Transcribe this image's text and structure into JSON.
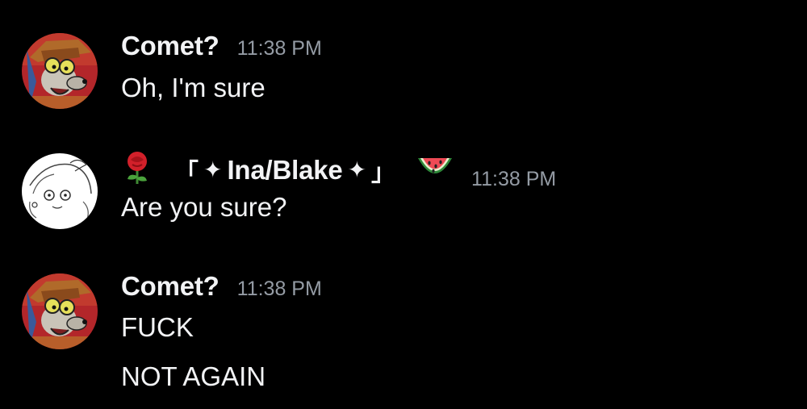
{
  "messages": [
    {
      "author": "Comet?",
      "timestamp": "11:38 PM",
      "lines": [
        "Oh, I'm sure"
      ]
    },
    {
      "author_prefix": "「",
      "author_sparkle_left": "✦",
      "author": "Ina/Blake",
      "author_sparkle_right": "✦",
      "author_suffix": "」",
      "timestamp": "11:38 PM",
      "lines": [
        "Are you sure?"
      ],
      "decorations": [
        "rose-emoji",
        "watermelon-emoji"
      ]
    },
    {
      "author": "Comet?",
      "timestamp": "11:38 PM",
      "lines": [
        "FUCK",
        "NOT AGAIN"
      ]
    }
  ],
  "colors": {
    "background": "#000000",
    "text": "#f2f3f5",
    "timestamp": "#949ba4"
  }
}
